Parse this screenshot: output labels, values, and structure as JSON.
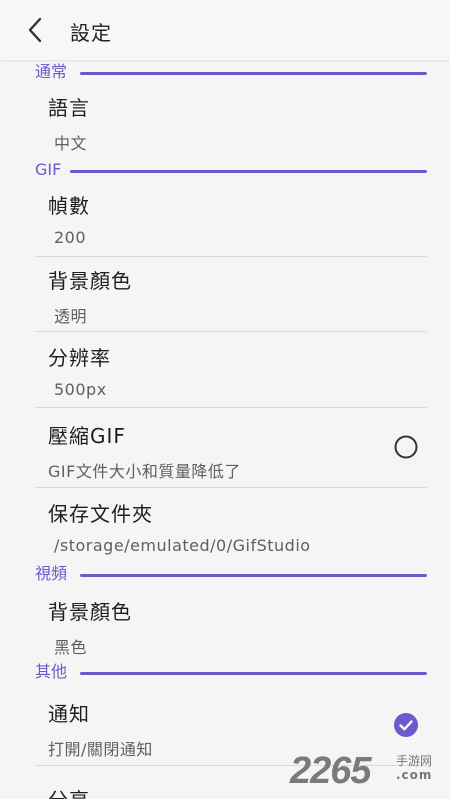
{
  "header": {
    "title": "設定",
    "back_icon": "chevron-left-icon"
  },
  "colors": {
    "accent": "#6a5acd",
    "checked": "#6a5acd"
  },
  "sections": {
    "general": {
      "label": "通常",
      "language": {
        "title": "語言",
        "value": "中文"
      }
    },
    "gif": {
      "label": "GIF",
      "frames": {
        "title": "幀數",
        "value": "200"
      },
      "background": {
        "title": "背景顏色",
        "value": "透明"
      },
      "resolution": {
        "title": "分辨率",
        "value": "500px"
      },
      "compress": {
        "title": "壓縮GIF",
        "value": "GIF文件大小和質量降低了",
        "checked": false
      },
      "save_folder": {
        "title": "保存文件夾",
        "value": "/storage/emulated/0/GifStudio"
      }
    },
    "video": {
      "label": "視頻",
      "background": {
        "title": "背景顏色",
        "value": "黑色"
      }
    },
    "other": {
      "label": "其他",
      "notify": {
        "title": "通知",
        "value": "打開/關閉通知",
        "checked": true
      },
      "share": {
        "title": "分享"
      }
    }
  },
  "watermark": {
    "number": "2265",
    "sub": "手游网",
    "domain": ".com"
  }
}
